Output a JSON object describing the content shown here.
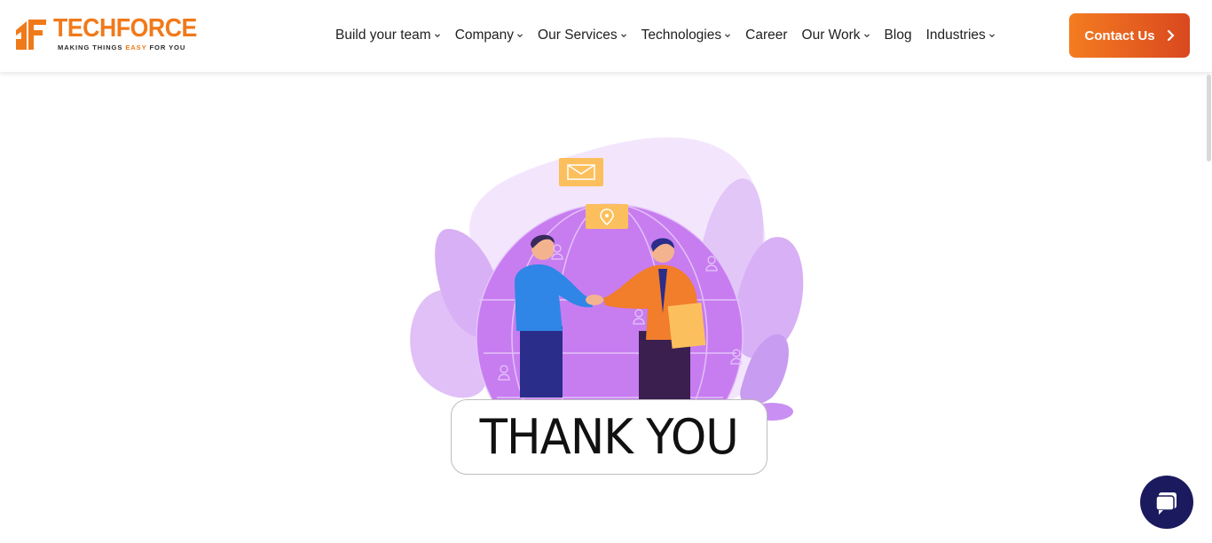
{
  "brand": {
    "name_part1": "TECH",
    "name_part2": "FORCE",
    "tagline_before": "MAKING THINGS ",
    "tagline_accent": "EASY",
    "tagline_after": " FOR YOU"
  },
  "nav": {
    "items": [
      {
        "label": "Build your team",
        "has_dropdown": true
      },
      {
        "label": "Company",
        "has_dropdown": true
      },
      {
        "label": "Our Services",
        "has_dropdown": true
      },
      {
        "label": "Technologies",
        "has_dropdown": true
      },
      {
        "label": "Career",
        "has_dropdown": false
      },
      {
        "label": "Our Work",
        "has_dropdown": true
      },
      {
        "label": "Blog",
        "has_dropdown": false
      },
      {
        "label": "Industries",
        "has_dropdown": true
      }
    ],
    "cta_label": "Contact Us"
  },
  "hero": {
    "message": "THANK YOU"
  },
  "icons": {
    "dropdown": "chevron-down-icon",
    "cta": "chevron-right-icon",
    "chat": "chat-bubble-icon",
    "envelope": "envelope-icon",
    "location": "map-pin-icon"
  },
  "colors": {
    "brand_orange": "#f07a1a",
    "cta_gradient_start": "#f47c20",
    "cta_gradient_end": "#d9481f",
    "chat_button": "#1c1a5e",
    "illustration_purple": "#c77df0"
  }
}
